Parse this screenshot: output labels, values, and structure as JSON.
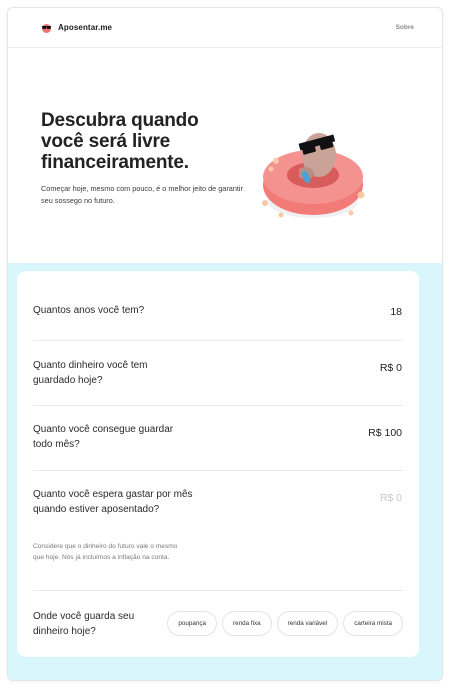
{
  "nav": {
    "brand": "Aposentar.me",
    "about_link": "Sobre"
  },
  "hero": {
    "title": "Descubra quando você será livre financeiramente.",
    "subtitle": "Começar hoje, mesmo com pouco, é o melhor jeito de garantir seu sossego no futuro."
  },
  "form": {
    "age": {
      "question": "Quantos anos você tem?",
      "value": "18"
    },
    "savings": {
      "question": "Quanto dinheiro você tem guardado hoje?",
      "value": "R$ 0"
    },
    "monthly": {
      "question": "Quanto você consegue guardar todo mês?",
      "value": "R$ 100"
    },
    "spending": {
      "question": "Quanto você espera gastar por mês quando estiver aposentado?",
      "placeholder": "R$ 0",
      "note": "Considere que o dinheiro do futuro vale o mesmo que hoje. Nós já incluímos a inflação na conta."
    },
    "investment": {
      "question": "Onde você guarda seu dinheiro hoje?",
      "options": [
        "poupança",
        "renda fixa",
        "renda variável",
        "carteira mista"
      ]
    }
  },
  "colors": {
    "panel": "#d9f6fd",
    "float": "#f0706d"
  }
}
